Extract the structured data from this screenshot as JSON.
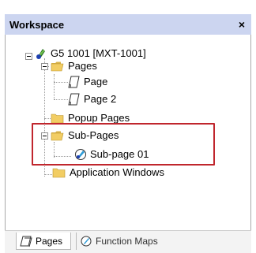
{
  "header": {
    "title": "Workspace",
    "close_glyph": "×"
  },
  "tree": {
    "device": {
      "label": "G5 1001 [MXT-1001]",
      "icon": "device-icon"
    },
    "pages": {
      "label": "Pages",
      "icon": "folder-open-icon"
    },
    "page": {
      "label": "Page",
      "icon": "page-icon"
    },
    "page2": {
      "label": "Page 2",
      "icon": "page-icon"
    },
    "popup_pages": {
      "label": "Popup Pages",
      "icon": "folder-icon"
    },
    "sub_pages": {
      "label": "Sub-Pages",
      "icon": "folder-open-icon"
    },
    "sub_page01": {
      "label": "Sub-page 01",
      "icon": "subpage-icon"
    },
    "app_windows": {
      "label": "Application Windows",
      "icon": "folder-icon"
    }
  },
  "highlight_color": "#c0262d",
  "tabs": [
    {
      "label": "Pages",
      "icon": "pages-tab-icon",
      "active": true
    },
    {
      "label": "Function Maps",
      "icon": "function-maps-icon",
      "active": false
    }
  ]
}
